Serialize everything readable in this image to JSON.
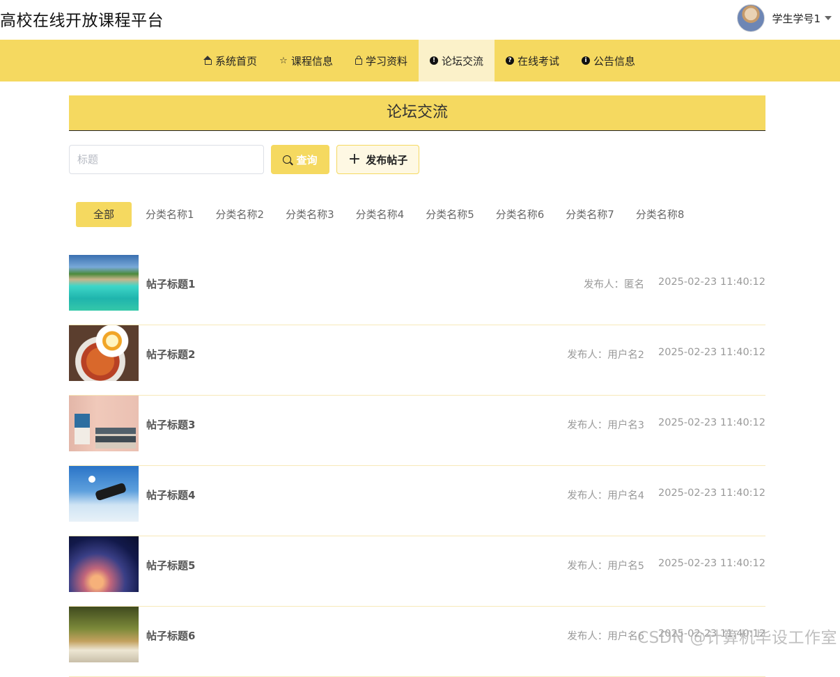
{
  "app": {
    "title": "高校在线开放课程平台",
    "user": {
      "name": "学生学号1",
      "avatar_icon": "user-avatar",
      "dropdown_icon": "caret-down-icon"
    }
  },
  "nav": {
    "items": [
      {
        "label": "系统首页",
        "icon": "home-icon",
        "active": false
      },
      {
        "label": "课程信息",
        "icon": "star-icon",
        "active": false
      },
      {
        "label": "学习资料",
        "icon": "bag-icon",
        "active": false
      },
      {
        "label": "论坛交流",
        "icon": "exclamation-circle-icon",
        "active": true
      },
      {
        "label": "在线考试",
        "icon": "question-circle-icon",
        "active": false
      },
      {
        "label": "公告信息",
        "icon": "info-circle-icon",
        "active": false
      }
    ]
  },
  "section": {
    "title": "论坛交流"
  },
  "search": {
    "placeholder": "标题",
    "value": "",
    "query_label": "查询",
    "post_label": "发布帖子"
  },
  "categories": {
    "items": [
      "全部",
      "分类名称1",
      "分类名称2",
      "分类名称3",
      "分类名称4",
      "分类名称5",
      "分类名称6",
      "分类名称7",
      "分类名称8"
    ],
    "active_index": 0
  },
  "posts": [
    {
      "title": "帖子标题1",
      "author": "发布人：匿名",
      "time": "2025-02-23 11:40:12"
    },
    {
      "title": "帖子标题2",
      "author": "发布人：用户名2",
      "time": "2025-02-23 11:40:12"
    },
    {
      "title": "帖子标题3",
      "author": "发布人：用户名3",
      "time": "2025-02-23 11:40:12"
    },
    {
      "title": "帖子标题4",
      "author": "发布人：用户名4",
      "time": "2025-02-23 11:40:12"
    },
    {
      "title": "帖子标题5",
      "author": "发布人：用户名5",
      "time": "2025-02-23 11:40:12"
    },
    {
      "title": "帖子标题6",
      "author": "发布人：用户名6",
      "time": "2025-02-23 11:40:12"
    }
  ],
  "watermark": "CSDN @计算机毕设工作室",
  "colors": {
    "accent": "#f5d960",
    "active_nav": "#fbf1c9",
    "row_border": "#f7e9b8"
  }
}
